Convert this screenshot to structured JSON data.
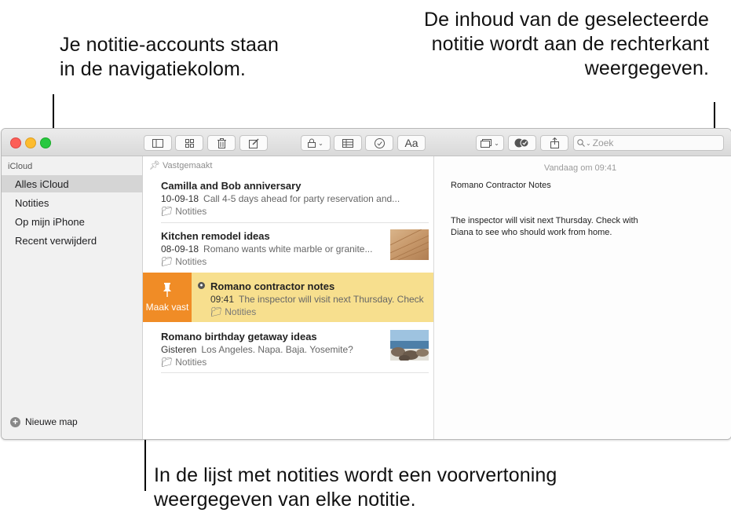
{
  "callouts": {
    "left": "Je notitie-accounts staan in de navigatiekolom.",
    "right": "De inhoud van de geselecteerde notitie wordt aan de rechterkant weergegeven.",
    "bottom": "In de lijst met notities wordt een voorvertoning weergegeven van elke notitie."
  },
  "toolbar": {
    "search_placeholder": "Zoek",
    "format_label": "Aa",
    "icons": [
      "sidebar-toggle-icon",
      "gallery-icon",
      "trash-icon",
      "compose-icon",
      "lock-icon",
      "table-icon",
      "checklist-icon",
      "format-icon",
      "media-icon",
      "collaborate-icon",
      "share-icon",
      "search-icon"
    ]
  },
  "sidebar": {
    "account": "iCloud",
    "items": [
      {
        "label": "Alles iCloud",
        "selected": true
      },
      {
        "label": "Notities"
      },
      {
        "label": "Op mijn iPhone"
      },
      {
        "label": "Recent verwijderd"
      }
    ],
    "new_folder": "Nieuwe map"
  },
  "list": {
    "pinned_header": "Vastgemaakt",
    "notes": [
      {
        "title": "Camilla and Bob anniversary",
        "date": "10-09-18",
        "preview": "Call 4-5 days ahead for party reservation and...",
        "folder": "Notities"
      },
      {
        "title": "Kitchen remodel ideas",
        "date": "08-09-18",
        "preview": "Romano wants white marble or granite...",
        "folder": "Notities",
        "thumbnail": "wood-floor"
      },
      {
        "title": "Romano contractor notes",
        "date": "09:41",
        "preview": "The inspector will visit next Thursday. Check",
        "folder": "Notities",
        "locked": true,
        "pin_action": "Maak vast",
        "highlight_color": "#f7df8e",
        "pin_color": "#f08c26"
      },
      {
        "title": "Romano birthday getaway ideas",
        "date": "Gisteren",
        "preview": "Los Angeles. Napa. Baja. Yosemite?",
        "folder": "Notities",
        "thumbnail": "beach-rocks"
      }
    ]
  },
  "detail": {
    "date": "Vandaag om 09:41",
    "title": "Romano Contractor Notes",
    "body": "The inspector will visit next Thursday. Check with Diana to see who should work from home."
  }
}
